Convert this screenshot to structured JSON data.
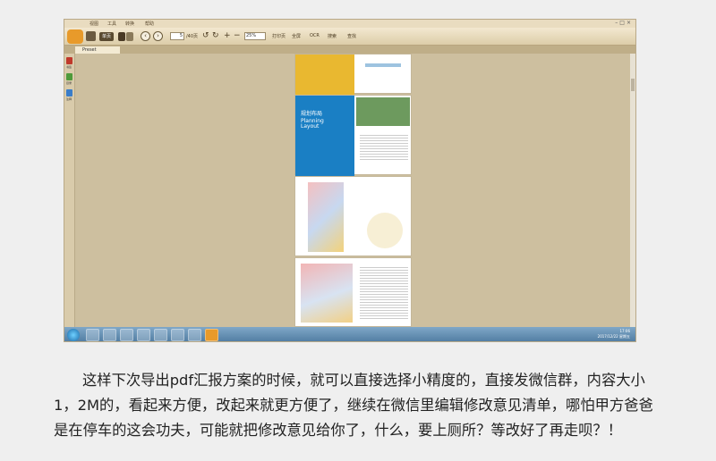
{
  "app": {
    "menus": [
      "视图",
      "工具",
      "转换",
      "帮助"
    ],
    "tab_label": "Preset",
    "toolbar": {
      "open_label": "单页",
      "page_current": "5",
      "page_total": "/40页",
      "zoom": "25%",
      "actions": [
        "打印页",
        "全屏",
        "OCR",
        "搜索",
        "查找"
      ]
    },
    "sidebar": [
      "书签",
      "目录",
      "注释"
    ],
    "pages": {
      "p2_title_cn": "规划布局",
      "p2_title_en_1": "Planning",
      "p2_title_en_2": "Layout"
    },
    "taskbar": {
      "time": "17:06",
      "date": "2017/12/22 星期五"
    },
    "colors": {
      "frame": "#cdbf9f",
      "accent_blue": "#1a7fc4",
      "accent_yellow": "#e9b830"
    }
  },
  "caption": {
    "line1": "这样下次导出pdf汇报方案的时候，就可以直接选择小精度的，直接发微信群，内容大小",
    "line2": "1，2M的，看起来方便，改起来就更方便了，继续在微信里编辑修改意见清单，哪怕甲方爸爸",
    "line3": "是在停车的这会功夫，可能就把修改意见给你了，什么，要上厕所？等改好了再走呗？！"
  }
}
